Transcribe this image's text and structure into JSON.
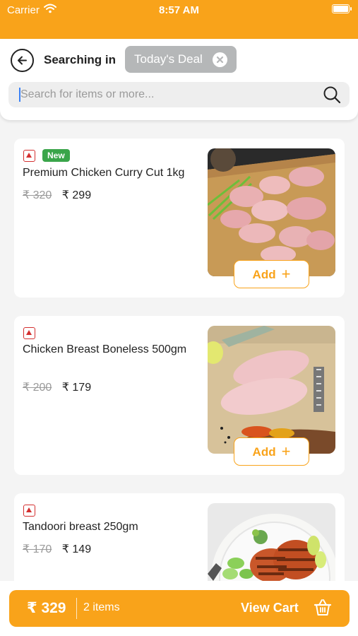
{
  "status_bar": {
    "carrier": "Carrier",
    "time": "8:57 AM"
  },
  "header": {
    "searching_label": "Searching in",
    "filter_chip": "Today's Deal",
    "search_placeholder": "Search for items or more..."
  },
  "products": [
    {
      "name": "Premium Chicken Curry Cut 1kg",
      "badge": "New",
      "old_price": "₹ 320",
      "price": "₹ 299",
      "add_label": "Add"
    },
    {
      "name": "Chicken Breast Boneless 500gm",
      "old_price": "₹ 200",
      "price": "₹ 179",
      "add_label": "Add"
    },
    {
      "name": "Tandoori breast 250gm",
      "old_price": "₹ 170",
      "price": "₹ 149"
    }
  ],
  "cart": {
    "total": "₹ 329",
    "count": "2 items",
    "cta": "View Cart"
  },
  "colors": {
    "accent": "#f9a31a",
    "new_badge": "#3aa54a",
    "non_veg": "#d32f2f",
    "chip": "#b5b7b8"
  },
  "icons": [
    "wifi-icon",
    "battery-icon",
    "back-arrow-icon",
    "close-icon",
    "search-icon",
    "non-veg-icon",
    "plus-icon",
    "basket-icon"
  ]
}
